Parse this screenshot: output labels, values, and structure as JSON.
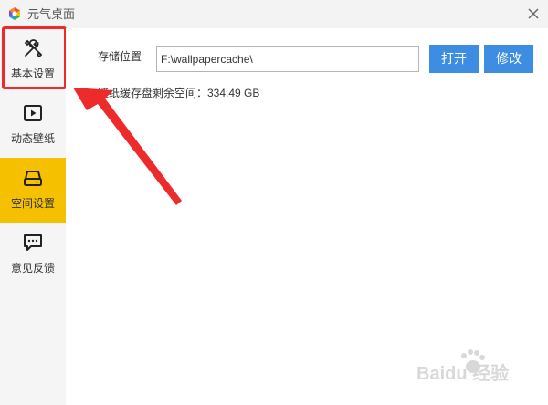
{
  "colors": {
    "accent": "#f4c000",
    "annotation": "#ee2b2b",
    "button": "#3d8de3"
  },
  "window": {
    "title": "元气桌面",
    "logo_icon": "yuanqi-logo-icon",
    "close_icon": "close-icon"
  },
  "sidebar": {
    "items": [
      {
        "label": "基本设置",
        "icon": "tools-icon",
        "active": false,
        "highlighted": true
      },
      {
        "label": "动态壁纸",
        "icon": "play-icon",
        "active": false,
        "highlighted": false
      },
      {
        "label": "空间设置",
        "icon": "drive-icon",
        "active": true,
        "highlighted": false
      },
      {
        "label": "意见反馈",
        "icon": "chat-bubble-icon",
        "active": false,
        "highlighted": false
      }
    ]
  },
  "storage": {
    "label": "存储位置",
    "path": "F:\\wallpapercache\\",
    "open_label": "打开",
    "edit_label": "修改",
    "free_space_text": "壁纸缓存盘剩余空间：334.49 GB"
  },
  "watermark": {
    "text": "Baidu 经验",
    "icon": "baidu-paw-icon"
  }
}
